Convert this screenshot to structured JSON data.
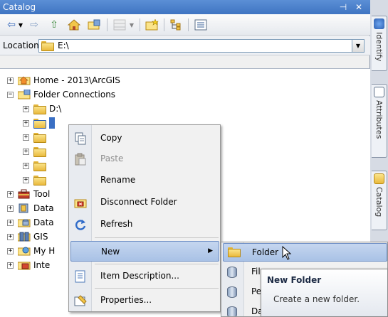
{
  "window": {
    "title": "Catalog",
    "pin_glyph": "⊣",
    "close_glyph": "✕"
  },
  "toolbar": {
    "icons": [
      "back-arrow-icon",
      "dropdown-icon",
      "forward-arrow-icon",
      "up-one-level-icon",
      "home-icon",
      "connect-folder-icon",
      "toggle-contents-icon",
      "views-dropdown-icon",
      "new-folder-toolbar-icon",
      "show-tree-icon",
      "options-icon"
    ]
  },
  "location": {
    "label": "Location:",
    "value": "E:\\"
  },
  "tree": {
    "items": [
      {
        "label": "Home - 2013\\ArcGIS",
        "expander": "+",
        "icon": "home-folder-icon"
      },
      {
        "label": "Folder Connections",
        "expander": "−",
        "icon": "folder-connections-icon"
      },
      {
        "label": "D:\\",
        "expander": "+",
        "icon": "folder-icon"
      },
      {
        "label": "",
        "expander": "+",
        "icon": "folder-icon"
      },
      {
        "label": "",
        "expander": "+",
        "icon": "folder-icon"
      },
      {
        "label": "",
        "expander": "+",
        "icon": "folder-icon"
      },
      {
        "label": "",
        "expander": "+",
        "icon": "folder-icon"
      },
      {
        "label": "",
        "expander": "+",
        "icon": "folder-icon"
      },
      {
        "label": "Tool",
        "expander": "+",
        "icon": "toolboxes-icon"
      },
      {
        "label": "Data",
        "expander": "+",
        "icon": "database-servers-icon"
      },
      {
        "label": "Data",
        "expander": "+",
        "icon": "database-connections-icon"
      },
      {
        "label": "GIS",
        "expander": "+",
        "icon": "gis-servers-icon"
      },
      {
        "label": "My H",
        "expander": "+",
        "icon": "my-hosted-services-icon"
      },
      {
        "label": "Inte",
        "expander": "+",
        "icon": "interoperability-icon"
      }
    ]
  },
  "context_menu": {
    "items": [
      {
        "label": "Copy",
        "enabled": true
      },
      {
        "label": "Paste",
        "enabled": false
      },
      {
        "label": "Rename",
        "enabled": true
      },
      {
        "label": "Disconnect Folder",
        "enabled": true
      },
      {
        "label": "Refresh",
        "enabled": true
      },
      {
        "label": "New",
        "enabled": true,
        "submenu_arrow": "▶"
      },
      {
        "label": "Item Description...",
        "enabled": true
      },
      {
        "label": "Properties...",
        "enabled": true
      }
    ]
  },
  "submenu": {
    "items": [
      {
        "label": "Folder"
      },
      {
        "label": "File"
      },
      {
        "label": "Pers"
      },
      {
        "label": "Data"
      }
    ]
  },
  "tooltip": {
    "title": "New Folder",
    "text": "Create a new folder."
  },
  "dock": {
    "tabs": [
      {
        "label": "Identify"
      },
      {
        "label": "Attributes"
      },
      {
        "label": "Catalog"
      }
    ]
  },
  "colors": {
    "title_bar": "#3f74c2",
    "menu_highlight": "#a9c2e6",
    "folder_yellow": "#e9b93d"
  }
}
